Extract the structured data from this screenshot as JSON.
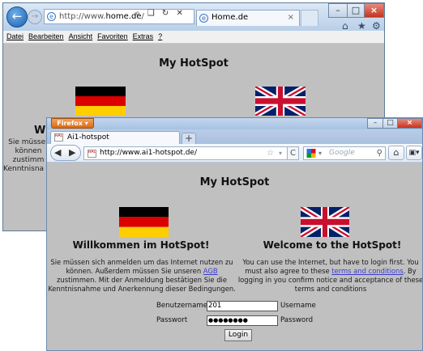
{
  "ie": {
    "address_prefix": "http://www.",
    "address_host": "home.de",
    "address_suffix": "/",
    "address_icons": "⌕ ❑ ↻ ✕",
    "tab_title": "Home.de",
    "menu": [
      "Datei",
      "Bearbeiten",
      "Ansicht",
      "Favoriten",
      "Extras",
      "?"
    ],
    "heading": "My HotSpot",
    "welcome_partial": "Wil",
    "text_partial": [
      "Sie müsser",
      "können",
      "zustimm",
      "Kenntnisna"
    ]
  },
  "firefox": {
    "menu_button": "Firefox",
    "tab_title": "Ai1-hotspot",
    "url": "http://www.ai1-hotspot.de/",
    "search_placeholder": "Google",
    "page": {
      "heading": "My HotSpot",
      "de": {
        "title": "Willkommen im HotSpot!",
        "text_before_link": "Sie müssen sich anmelden um das Internet nutzen zu können. Außerdem müssen Sie unseren ",
        "link": "AGB",
        "text_after_link": " zustimmen. Mit der Anmeldung bestätigen Sie die Kenntnisnahme und Anerkennung dieser Bedingungen."
      },
      "en": {
        "title": "Welcome to the HotSpot!",
        "text_before_link": "You can use the Internet, but have to login first. You must also agree to these ",
        "link": "terms and conditions",
        "text_after_link": ". By logging in you confirm notice and acceptance of these terms and conditions"
      },
      "form": {
        "username_label_de": "Benutzername",
        "username_label_en": "Username",
        "username_value": "201",
        "password_label_de": "Passwort",
        "password_label_en": "Password",
        "password_value": "●●●●●●●●",
        "login_label": "Login"
      }
    }
  }
}
